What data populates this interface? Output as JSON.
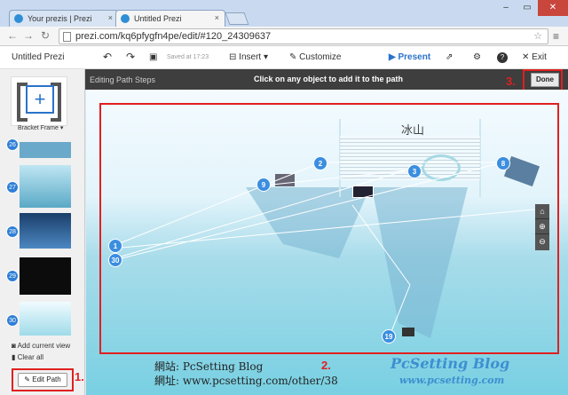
{
  "browser": {
    "tabs": [
      {
        "label": "Your prezis | Prezi",
        "close": "×"
      },
      {
        "label": "Untitled Prezi",
        "close": "×"
      }
    ],
    "url": "prezi.com/kq6pfygfn4pe/edit/#120_24309637",
    "window_controls": {
      "minimize": "–",
      "maximize": "▭",
      "close": "✕"
    }
  },
  "toolbar": {
    "title": "Untitled Prezi",
    "saved": "Saved at 17:23",
    "insert": "Insert ▾",
    "customize": "Customize",
    "present": "Present",
    "help": "?",
    "exit": "Exit"
  },
  "pathbar": {
    "left": "Editing Path Steps",
    "center": "Click on any object to add it to the path",
    "done": "Done"
  },
  "sidebar": {
    "frame_label": "Bracket Frame ▾",
    "thumbs": [
      "26",
      "27",
      "28",
      "29",
      "30"
    ],
    "add_current_view": "Add current view",
    "clear_all": "Clear all",
    "edit_path": "Edit Path"
  },
  "annotations": {
    "one": "1.",
    "two": "2.",
    "three": "3."
  },
  "canvas": {
    "heading": "冰山",
    "nodes": [
      "1",
      "30",
      "2",
      "9",
      "3",
      "8",
      "19"
    ],
    "footer_line1": "網站: PcSetting Blog",
    "footer_line2": "網址: www.pcsetting.com/other/38"
  },
  "watermark": {
    "line1": "PcSetting Blog",
    "line2": "www.pcsetting.com"
  },
  "colors": {
    "accent": "#2f7fd6",
    "highlight": "#e02020",
    "pathbar": "#3e3e3e"
  }
}
